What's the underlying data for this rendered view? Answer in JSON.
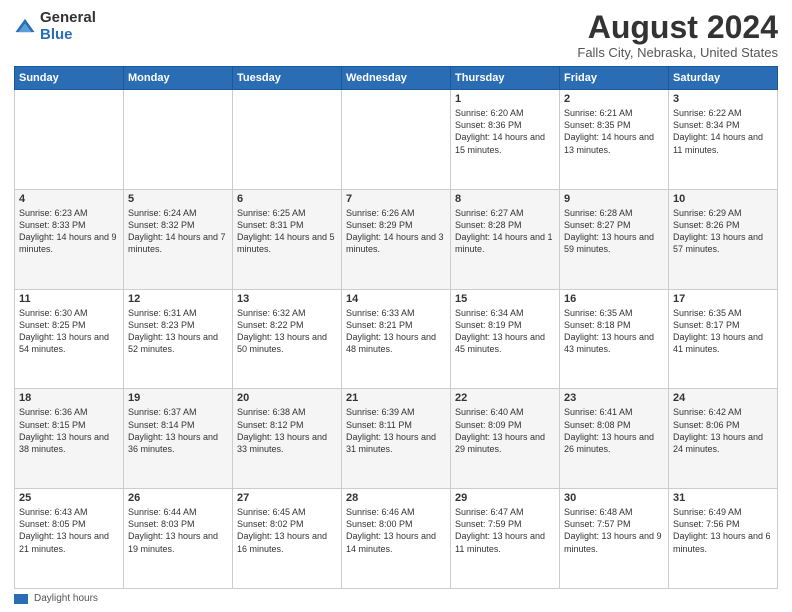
{
  "logo": {
    "general": "General",
    "blue": "Blue"
  },
  "title": "August 2024",
  "subtitle": "Falls City, Nebraska, United States",
  "days_header": [
    "Sunday",
    "Monday",
    "Tuesday",
    "Wednesday",
    "Thursday",
    "Friday",
    "Saturday"
  ],
  "footer_label": "Daylight hours",
  "weeks": [
    {
      "row_class": "row-white",
      "days": [
        {
          "num": "",
          "info": ""
        },
        {
          "num": "",
          "info": ""
        },
        {
          "num": "",
          "info": ""
        },
        {
          "num": "",
          "info": ""
        },
        {
          "num": "1",
          "info": "Sunrise: 6:20 AM\nSunset: 8:36 PM\nDaylight: 14 hours and 15 minutes."
        },
        {
          "num": "2",
          "info": "Sunrise: 6:21 AM\nSunset: 8:35 PM\nDaylight: 14 hours and 13 minutes."
        },
        {
          "num": "3",
          "info": "Sunrise: 6:22 AM\nSunset: 8:34 PM\nDaylight: 14 hours and 11 minutes."
        }
      ]
    },
    {
      "row_class": "row-gray",
      "days": [
        {
          "num": "4",
          "info": "Sunrise: 6:23 AM\nSunset: 8:33 PM\nDaylight: 14 hours and 9 minutes."
        },
        {
          "num": "5",
          "info": "Sunrise: 6:24 AM\nSunset: 8:32 PM\nDaylight: 14 hours and 7 minutes."
        },
        {
          "num": "6",
          "info": "Sunrise: 6:25 AM\nSunset: 8:31 PM\nDaylight: 14 hours and 5 minutes."
        },
        {
          "num": "7",
          "info": "Sunrise: 6:26 AM\nSunset: 8:29 PM\nDaylight: 14 hours and 3 minutes."
        },
        {
          "num": "8",
          "info": "Sunrise: 6:27 AM\nSunset: 8:28 PM\nDaylight: 14 hours and 1 minute."
        },
        {
          "num": "9",
          "info": "Sunrise: 6:28 AM\nSunset: 8:27 PM\nDaylight: 13 hours and 59 minutes."
        },
        {
          "num": "10",
          "info": "Sunrise: 6:29 AM\nSunset: 8:26 PM\nDaylight: 13 hours and 57 minutes."
        }
      ]
    },
    {
      "row_class": "row-white",
      "days": [
        {
          "num": "11",
          "info": "Sunrise: 6:30 AM\nSunset: 8:25 PM\nDaylight: 13 hours and 54 minutes."
        },
        {
          "num": "12",
          "info": "Sunrise: 6:31 AM\nSunset: 8:23 PM\nDaylight: 13 hours and 52 minutes."
        },
        {
          "num": "13",
          "info": "Sunrise: 6:32 AM\nSunset: 8:22 PM\nDaylight: 13 hours and 50 minutes."
        },
        {
          "num": "14",
          "info": "Sunrise: 6:33 AM\nSunset: 8:21 PM\nDaylight: 13 hours and 48 minutes."
        },
        {
          "num": "15",
          "info": "Sunrise: 6:34 AM\nSunset: 8:19 PM\nDaylight: 13 hours and 45 minutes."
        },
        {
          "num": "16",
          "info": "Sunrise: 6:35 AM\nSunset: 8:18 PM\nDaylight: 13 hours and 43 minutes."
        },
        {
          "num": "17",
          "info": "Sunrise: 6:35 AM\nSunset: 8:17 PM\nDaylight: 13 hours and 41 minutes."
        }
      ]
    },
    {
      "row_class": "row-gray",
      "days": [
        {
          "num": "18",
          "info": "Sunrise: 6:36 AM\nSunset: 8:15 PM\nDaylight: 13 hours and 38 minutes."
        },
        {
          "num": "19",
          "info": "Sunrise: 6:37 AM\nSunset: 8:14 PM\nDaylight: 13 hours and 36 minutes."
        },
        {
          "num": "20",
          "info": "Sunrise: 6:38 AM\nSunset: 8:12 PM\nDaylight: 13 hours and 33 minutes."
        },
        {
          "num": "21",
          "info": "Sunrise: 6:39 AM\nSunset: 8:11 PM\nDaylight: 13 hours and 31 minutes."
        },
        {
          "num": "22",
          "info": "Sunrise: 6:40 AM\nSunset: 8:09 PM\nDaylight: 13 hours and 29 minutes."
        },
        {
          "num": "23",
          "info": "Sunrise: 6:41 AM\nSunset: 8:08 PM\nDaylight: 13 hours and 26 minutes."
        },
        {
          "num": "24",
          "info": "Sunrise: 6:42 AM\nSunset: 8:06 PM\nDaylight: 13 hours and 24 minutes."
        }
      ]
    },
    {
      "row_class": "row-white",
      "days": [
        {
          "num": "25",
          "info": "Sunrise: 6:43 AM\nSunset: 8:05 PM\nDaylight: 13 hours and 21 minutes."
        },
        {
          "num": "26",
          "info": "Sunrise: 6:44 AM\nSunset: 8:03 PM\nDaylight: 13 hours and 19 minutes."
        },
        {
          "num": "27",
          "info": "Sunrise: 6:45 AM\nSunset: 8:02 PM\nDaylight: 13 hours and 16 minutes."
        },
        {
          "num": "28",
          "info": "Sunrise: 6:46 AM\nSunset: 8:00 PM\nDaylight: 13 hours and 14 minutes."
        },
        {
          "num": "29",
          "info": "Sunrise: 6:47 AM\nSunset: 7:59 PM\nDaylight: 13 hours and 11 minutes."
        },
        {
          "num": "30",
          "info": "Sunrise: 6:48 AM\nSunset: 7:57 PM\nDaylight: 13 hours and 9 minutes."
        },
        {
          "num": "31",
          "info": "Sunrise: 6:49 AM\nSunset: 7:56 PM\nDaylight: 13 hours and 6 minutes."
        }
      ]
    }
  ]
}
